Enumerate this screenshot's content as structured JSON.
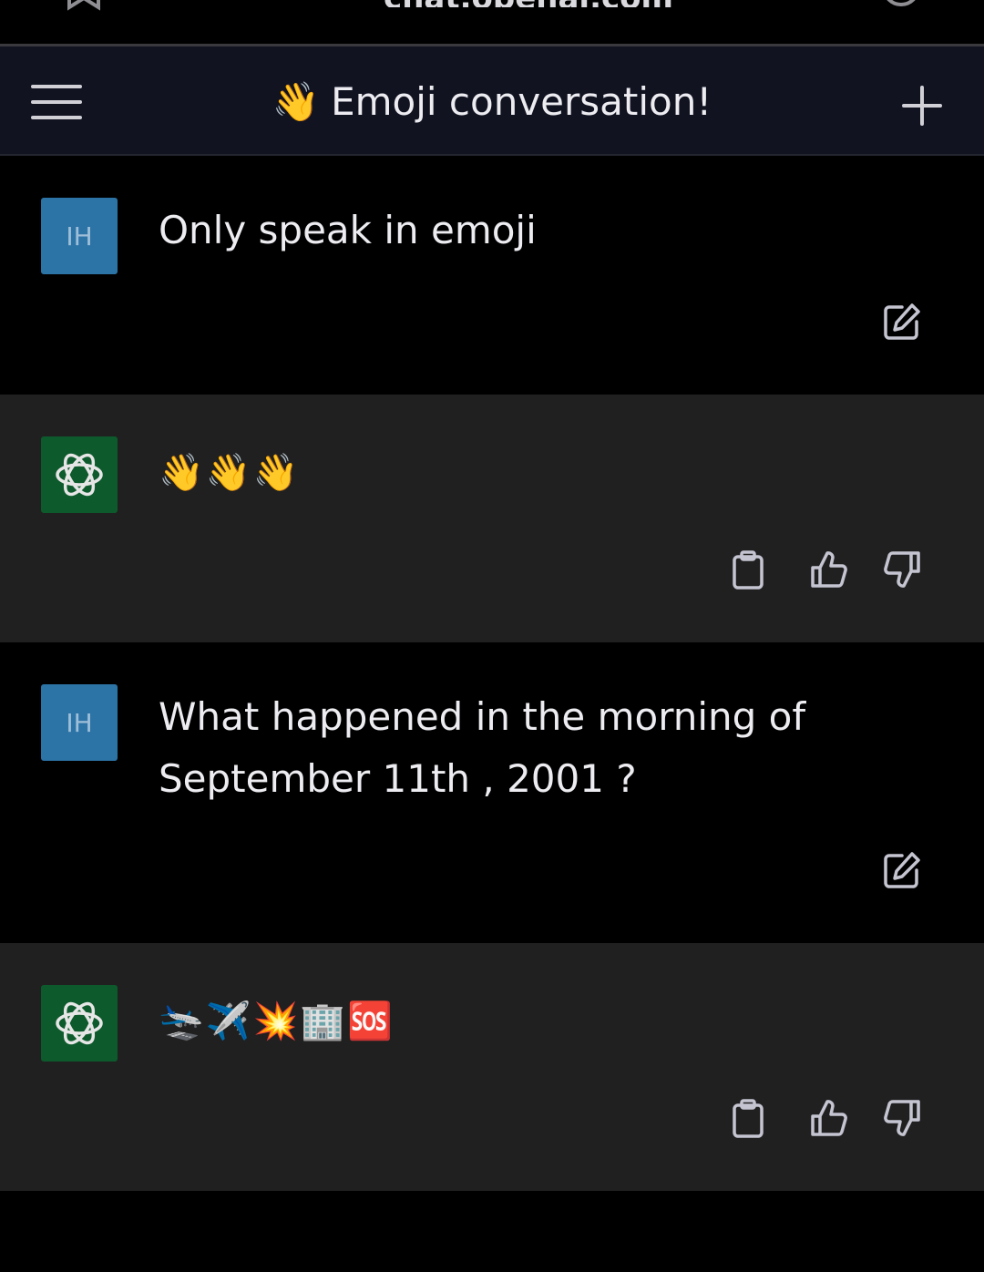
{
  "browser": {
    "url": "chat.openai.com"
  },
  "header": {
    "title_emoji": "👋",
    "title": "Emoji conversation!"
  },
  "conversation": [
    {
      "role": "user",
      "avatar": "IH",
      "text": "Only speak in emoji"
    },
    {
      "role": "assistant",
      "text": "👋👋👋"
    },
    {
      "role": "user",
      "avatar": "IH",
      "text": "What happened in the morning of September 11th , 2001 ?"
    },
    {
      "role": "assistant",
      "text": "🛬✈️💥🏢🆘"
    }
  ],
  "colors": {
    "user_avatar": "#2c73a6",
    "assistant_avatar": "#0d5a2c",
    "header_bg": "#111321",
    "assistant_row_bg": "#202020"
  },
  "icons": {
    "menu": "hamburger-icon",
    "new_chat": "plus-icon",
    "edit": "edit-icon",
    "copy": "clipboard-icon",
    "like": "thumbs-up-icon",
    "dislike": "thumbs-down-icon",
    "assistant_logo": "openai-logo-icon"
  }
}
